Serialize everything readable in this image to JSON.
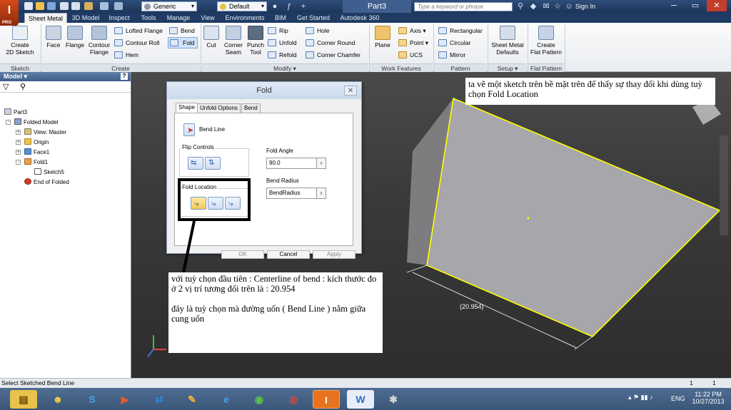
{
  "app": {
    "logo_letter": "I",
    "logo_sub": "PRO"
  },
  "titlebar": {
    "material_select": "Generic",
    "appearance_select": "Default",
    "doc_title": "Part3",
    "search_placeholder": "Type a keyword or phrase",
    "signin": "Sign In"
  },
  "tabs": [
    "Sheet Metal",
    "3D Model",
    "Inspect",
    "Tools",
    "Manage",
    "View",
    "Environments",
    "BIM",
    "Get Started",
    "Autodesk 360"
  ],
  "ribbon": {
    "sketch": {
      "create": "Create\n2D Sketch",
      "group": "Sketch"
    },
    "create": {
      "face": "Face",
      "flange": "Flange",
      "contour_flange": "Contour\nFlange",
      "lofted_flange": "Lofted Flange",
      "contour_roll": "Contour Roll",
      "hem": "Hem",
      "bend": "Bend",
      "fold": "Fold",
      "group": "Create"
    },
    "modify": {
      "cut": "Cut",
      "corner_seam": "Corner\nSeam",
      "punch_tool": "Punch\nTool",
      "rip": "Rip",
      "unfold": "Unfold",
      "refold": "Refold",
      "hole": "Hole",
      "corner_round": "Corner Round",
      "corner_chamfer": "Corner Chamfer",
      "group": "Modify ▾"
    },
    "work": {
      "plane": "Plane",
      "axis": "Axis ▾",
      "point": "Point ▾",
      "ucs": "UCS",
      "group": "Work Features"
    },
    "pattern": {
      "rectangular": "Rectangular",
      "circular": "Circular",
      "mirror": "Mirror",
      "group": "Pattern"
    },
    "setup": {
      "defaults": "Sheet Metal\nDefaults",
      "group": "Setup ▾"
    },
    "flat": {
      "create_flat": "Create\nFlat Pattern",
      "group": "Flat Pattern"
    }
  },
  "browser": {
    "title": "Model ▾",
    "help": "?",
    "tree": [
      "Part3",
      "Folded Model",
      "View: Master",
      "Origin",
      "Face1",
      "Fold1",
      "Sketch5",
      "End of Folded"
    ]
  },
  "dialog": {
    "title": "Fold",
    "tabs": [
      "Shape",
      "Unfold Options",
      "Bend"
    ],
    "bend_line": "Bend Line",
    "flip_controls": "Flip Controls",
    "fold_location": "Fold Location",
    "fold_angle_label": "Fold Angle",
    "fold_angle_value": "90.0",
    "bend_radius_label": "Bend Radius",
    "bend_radius_value": "BendRadius",
    "ok": "OK",
    "cancel": "Cancel",
    "apply": "Apply",
    "close": "✕"
  },
  "notes": {
    "top": "ta vẽ một sketch trên bề mặt trên để thấy sự thay đổi khi dùng tuỳ chọn Fold Location",
    "bottom_1": "với tuỳ chọn đầu tiên : Centerline of bend : kích thước đo ở 2 vị trí tương đối trên là : 20.954",
    "bottom_2": "đây là tuỳ chọn mà đường uốn ( Bend Line ) nằm giữa cung uốn"
  },
  "dimension": "(20.954)",
  "status": {
    "text": "Select Sketched Bend Line",
    "v1": "1",
    "v2": "1"
  },
  "taskbar": {
    "lang": "ENG",
    "time": "11:22 PM",
    "date": "10/27/2013"
  },
  "colors": {
    "edge_highlight": "#ffff00",
    "accent": "#1f3b63",
    "active_app": "#e8731c"
  }
}
